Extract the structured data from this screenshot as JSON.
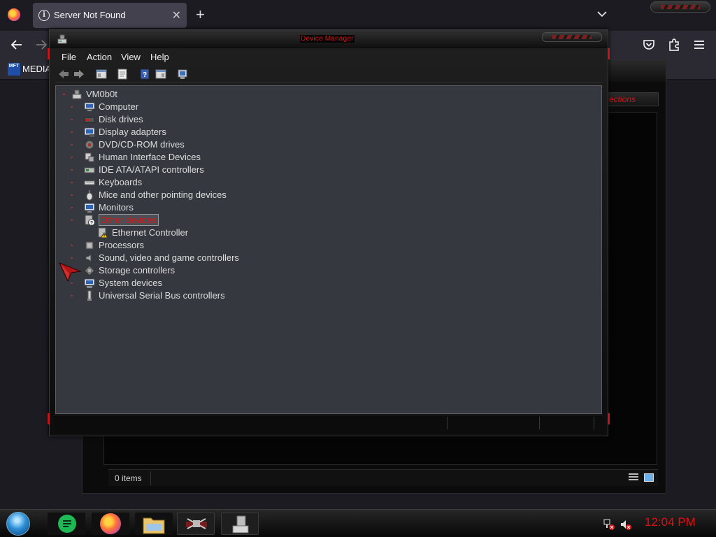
{
  "browser": {
    "tab_title": "Server Not Found",
    "bookmark_label": "MEDIA",
    "bookmark_icon_text": "MFT"
  },
  "background_window": {
    "connections_label": "ections",
    "status_text": "0 items"
  },
  "device_manager": {
    "title": "Device Manager",
    "menu": [
      "File",
      "Action",
      "View",
      "Help"
    ],
    "tree": {
      "root": "VM0b0t",
      "items": [
        {
          "label": "Computer",
          "icon": "computer-icon"
        },
        {
          "label": "Disk drives",
          "icon": "disk-drive-icon"
        },
        {
          "label": "Display adapters",
          "icon": "display-adapter-icon"
        },
        {
          "label": "DVD/CD-ROM drives",
          "icon": "dvd-drive-icon"
        },
        {
          "label": "Human Interface Devices",
          "icon": "hid-icon"
        },
        {
          "label": "IDE ATA/ATAPI controllers",
          "icon": "ide-controller-icon"
        },
        {
          "label": "Keyboards",
          "icon": "keyboard-icon"
        },
        {
          "label": "Mice and other pointing devices",
          "icon": "mouse-icon"
        },
        {
          "label": "Monitors",
          "icon": "monitor-icon"
        },
        {
          "label": "Other devices",
          "icon": "unknown-device-icon",
          "selected": true
        },
        {
          "label": "Ethernet Controller",
          "icon": "warning-device-icon",
          "child": true
        },
        {
          "label": "Processors",
          "icon": "processor-icon"
        },
        {
          "label": "Sound, video and game controllers",
          "icon": "speaker-icon"
        },
        {
          "label": "Storage controllers",
          "icon": "storage-icon"
        },
        {
          "label": "System devices",
          "icon": "system-device-icon"
        },
        {
          "label": "Universal Serial Bus controllers",
          "icon": "usb-icon"
        }
      ]
    }
  },
  "taskbar": {
    "clock": "12:04 PM",
    "apps": [
      "notes-app-icon",
      "firefox-icon",
      "file-explorer-icon",
      "device-manager-app-icon",
      "system-app-icon"
    ]
  },
  "colors": {
    "accent_red": "#e01010",
    "tree_background": "#35393f",
    "chrome_dark": "#1c1b22"
  }
}
